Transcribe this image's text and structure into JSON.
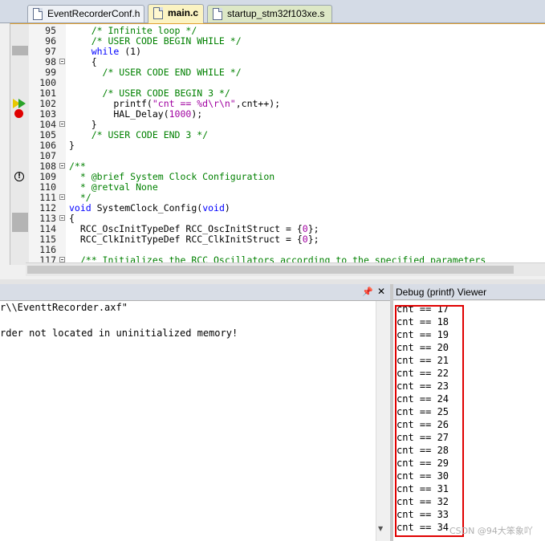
{
  "tabs": [
    {
      "label": "EventRecorderConf.h"
    },
    {
      "label": "main.c"
    },
    {
      "label": "startup_stm32f103xe.s"
    }
  ],
  "editor": {
    "lines": [
      {
        "n": "95",
        "parts": [
          {
            "c": "cm",
            "t": "    /* Infinite loop */"
          }
        ]
      },
      {
        "n": "96",
        "parts": [
          {
            "c": "cm",
            "t": "    /* USER CODE BEGIN WHILE */"
          }
        ]
      },
      {
        "n": "97",
        "parts": [
          {
            "c": "kw",
            "t": "    while"
          },
          {
            "c": "tx",
            "t": " (1)"
          }
        ]
      },
      {
        "n": "98",
        "parts": [
          {
            "c": "tx",
            "t": "    {"
          }
        ]
      },
      {
        "n": "99",
        "parts": [
          {
            "c": "cm",
            "t": "      /* USER CODE END WHILE */"
          }
        ]
      },
      {
        "n": "100",
        "parts": []
      },
      {
        "n": "101",
        "parts": [
          {
            "c": "cm",
            "t": "      /* USER CODE BEGIN 3 */"
          }
        ]
      },
      {
        "n": "102",
        "parts": [
          {
            "c": "tx",
            "t": "        printf("
          },
          {
            "c": "st",
            "t": "\"cnt == %d\\r\\n\""
          },
          {
            "c": "tx",
            "t": ",cnt++);"
          }
        ]
      },
      {
        "n": "103",
        "parts": [
          {
            "c": "tx",
            "t": "        HAL_Delay("
          },
          {
            "c": "nm",
            "t": "1000"
          },
          {
            "c": "tx",
            "t": ");"
          }
        ]
      },
      {
        "n": "104",
        "parts": [
          {
            "c": "tx",
            "t": "    }"
          }
        ]
      },
      {
        "n": "105",
        "parts": [
          {
            "c": "cm",
            "t": "    /* USER CODE END 3 */"
          }
        ]
      },
      {
        "n": "106",
        "parts": [
          {
            "c": "tx",
            "t": "}"
          }
        ]
      },
      {
        "n": "107",
        "parts": []
      },
      {
        "n": "108",
        "parts": [
          {
            "c": "cm",
            "t": "/**"
          }
        ]
      },
      {
        "n": "109",
        "parts": [
          {
            "c": "cm",
            "t": "  * @brief System Clock Configuration"
          }
        ]
      },
      {
        "n": "110",
        "parts": [
          {
            "c": "cm",
            "t": "  * @retval None"
          }
        ]
      },
      {
        "n": "111",
        "parts": [
          {
            "c": "cm",
            "t": "  */"
          }
        ]
      },
      {
        "n": "112",
        "parts": [
          {
            "c": "kw",
            "t": "void"
          },
          {
            "c": "tx",
            "t": " SystemClock_Config("
          },
          {
            "c": "kw",
            "t": "void"
          },
          {
            "c": "tx",
            "t": ")"
          }
        ]
      },
      {
        "n": "113",
        "parts": [
          {
            "c": "tx",
            "t": "{"
          }
        ]
      },
      {
        "n": "114",
        "parts": [
          {
            "c": "tx",
            "t": "  RCC_OscInitTypeDef RCC_OscInitStruct = {"
          },
          {
            "c": "nm",
            "t": "0"
          },
          {
            "c": "tx",
            "t": "};"
          }
        ]
      },
      {
        "n": "115",
        "parts": [
          {
            "c": "tx",
            "t": "  RCC_ClkInitTypeDef RCC_ClkInitStruct = {"
          },
          {
            "c": "nm",
            "t": "0"
          },
          {
            "c": "tx",
            "t": "};"
          }
        ]
      },
      {
        "n": "116",
        "parts": []
      },
      {
        "n": "117",
        "parts": [
          {
            "c": "cm",
            "t": "  /** Initializes the RCC Oscillators according to the specified parameters"
          }
        ]
      }
    ]
  },
  "build_output": {
    "lines": [
      "r\\\\EventtRecorder.axf\"",
      "",
      "rder not located in uninitialized memory!"
    ]
  },
  "debug_viewer": {
    "title": "Debug (printf) Viewer",
    "lines": [
      "cnt == 17",
      "cnt == 18",
      "cnt == 19",
      "cnt == 20",
      "cnt == 21",
      "cnt == 22",
      "cnt == 23",
      "cnt == 24",
      "cnt == 25",
      "cnt == 26",
      "cnt == 27",
      "cnt == 28",
      "cnt == 29",
      "cnt == 30",
      "cnt == 31",
      "cnt == 32",
      "cnt == 33",
      "cnt == 34"
    ],
    "highlight_color": "#e00000"
  },
  "watermark": "CSDN @94大笨象吖",
  "icons": [
    "file-icon",
    "execution-arrow-icon",
    "breakpoint-icon",
    "warning-icon",
    "pin-icon",
    "close-icon",
    "fold-icon"
  ]
}
